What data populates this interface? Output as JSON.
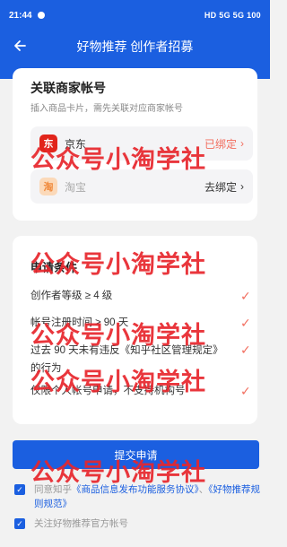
{
  "status_bar": {
    "time": "21:44",
    "indicators": "HD 5G 5G 100"
  },
  "nav": {
    "title": "好物推荐 创作者招募",
    "back_icon": "arrow-left-icon"
  },
  "merchant": {
    "title": "关联商家帐号",
    "subtitle": "插入商品卡片，需先关联对应商家帐号",
    "shops": [
      {
        "icon": "jd-logo",
        "icon_text": "东",
        "name": "京东",
        "action": "已绑定",
        "bound": true
      },
      {
        "icon": "taobao-logo",
        "icon_text": "淘",
        "name": "淘宝",
        "action": "去绑定",
        "bound": false
      }
    ]
  },
  "conditions": {
    "title": "申请条件",
    "items": [
      "创作者等级 ≥ 4 级",
      "帐号注册时间 ≥ 90 天",
      "过去 90 天未有违反《知乎社区管理规定》的行为",
      "仅限个人帐号申请，不支持机构号"
    ]
  },
  "submit_label": "提交申请",
  "agreements": {
    "prefix": "同意知乎",
    "link1": "《商品信息发布功能服务协议》",
    "sep": "、",
    "link2": "《好物推荐规则规范》",
    "follow": "关注好物推荐官方帐号"
  },
  "watermark": "公众号小淘学社",
  "colors": {
    "brand_blue": "#1b5fe0",
    "check_red": "#f26e5f",
    "watermark_red": "#e8262c"
  }
}
